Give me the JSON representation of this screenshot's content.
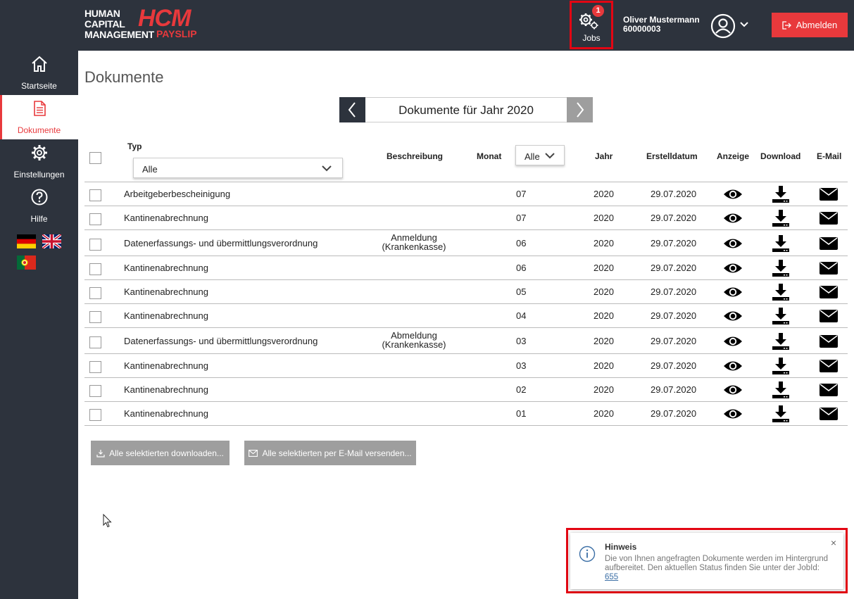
{
  "header": {
    "logo_line1": "HUMAN",
    "logo_line2": "CAPITAL",
    "logo_line3": "MANAGEMENT",
    "logo_hcm": "HCM",
    "logo_payslip": "PAYSLIP",
    "jobs_label": "Jobs",
    "jobs_badge": "1",
    "user_name": "Oliver Mustermann",
    "user_id": "60000003",
    "logout_label": "Abmelden"
  },
  "sidebar": {
    "items": [
      {
        "label": "Startseite",
        "icon": "home-icon"
      },
      {
        "label": "Dokumente",
        "icon": "document-icon"
      },
      {
        "label": "Einstellungen",
        "icon": "gear-icon"
      },
      {
        "label": "Hilfe",
        "icon": "help-icon"
      }
    ]
  },
  "main": {
    "title": "Dokumente",
    "year_label": "Dokumente für Jahr 2020",
    "columns": {
      "typ": "Typ",
      "beschreibung": "Beschreibung",
      "monat": "Monat",
      "jahr": "Jahr",
      "erstelldatum": "Erstelldatum",
      "anzeige": "Anzeige",
      "download": "Download",
      "email": "E-Mail"
    },
    "typ_filter": "Alle",
    "monat_filter": "Alle",
    "rows": [
      {
        "typ": "Arbeitgeberbescheinigung",
        "desc1": "",
        "desc2": "",
        "monat": "07",
        "jahr": "2020",
        "datum": "29.07.2020"
      },
      {
        "typ": "Kantinenabrechnung",
        "desc1": "",
        "desc2": "",
        "monat": "07",
        "jahr": "2020",
        "datum": "29.07.2020"
      },
      {
        "typ": "Datenerfassungs- und übermittlungsverordnung",
        "desc1": "Anmeldung",
        "desc2": "(Krankenkasse)",
        "monat": "06",
        "jahr": "2020",
        "datum": "29.07.2020"
      },
      {
        "typ": "Kantinenabrechnung",
        "desc1": "",
        "desc2": "",
        "monat": "06",
        "jahr": "2020",
        "datum": "29.07.2020"
      },
      {
        "typ": "Kantinenabrechnung",
        "desc1": "",
        "desc2": "",
        "monat": "05",
        "jahr": "2020",
        "datum": "29.07.2020"
      },
      {
        "typ": "Kantinenabrechnung",
        "desc1": "",
        "desc2": "",
        "monat": "04",
        "jahr": "2020",
        "datum": "29.07.2020"
      },
      {
        "typ": "Datenerfassungs- und übermittlungsverordnung",
        "desc1": "Abmeldung",
        "desc2": "(Krankenkasse)",
        "monat": "03",
        "jahr": "2020",
        "datum": "29.07.2020"
      },
      {
        "typ": "Kantinenabrechnung",
        "desc1": "",
        "desc2": "",
        "monat": "03",
        "jahr": "2020",
        "datum": "29.07.2020"
      },
      {
        "typ": "Kantinenabrechnung",
        "desc1": "",
        "desc2": "",
        "monat": "02",
        "jahr": "2020",
        "datum": "29.07.2020"
      },
      {
        "typ": "Kantinenabrechnung",
        "desc1": "",
        "desc2": "",
        "monat": "01",
        "jahr": "2020",
        "datum": "29.07.2020"
      }
    ],
    "download_all_label": "Alle selektierten downloaden...",
    "email_all_label": "Alle selektierten per E-Mail versenden..."
  },
  "toast": {
    "title": "Hinweis",
    "text": "Die von Ihnen angefragten Dokumente werden im Hintergrund aufbereitet. Den aktuellen Status finden Sie unter der JobId: ",
    "job_id": "655",
    "close": "×"
  },
  "colors": {
    "accent": "#e8393c",
    "dark": "#2d333d",
    "highlight": "#e30613"
  }
}
